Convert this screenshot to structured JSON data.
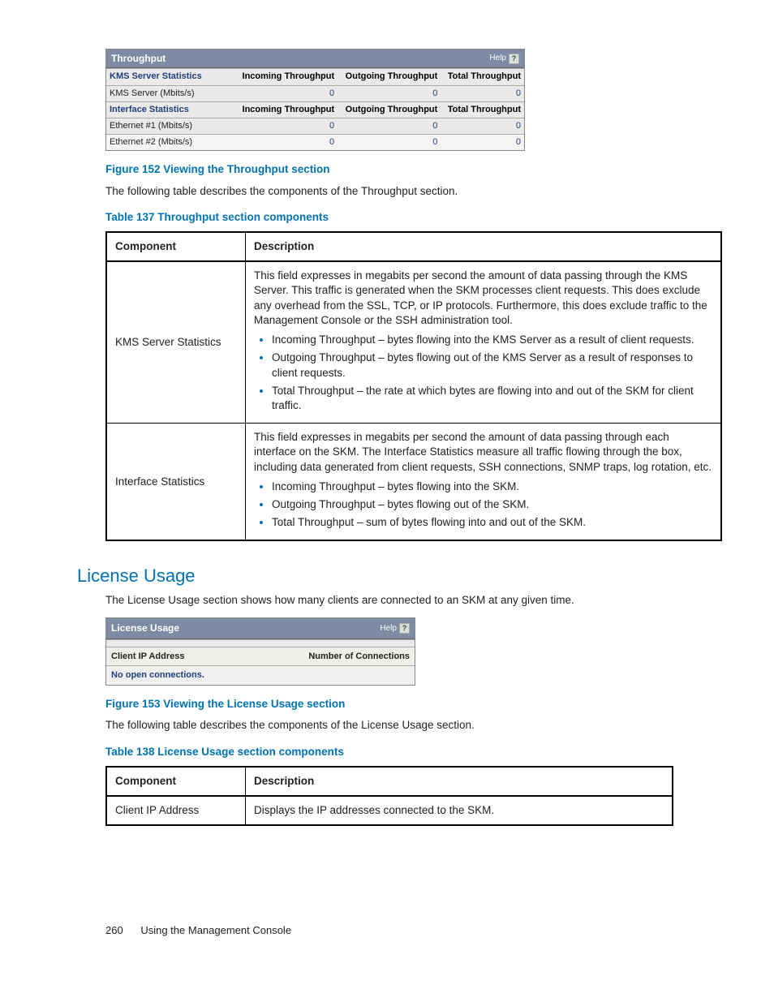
{
  "throughput_widget": {
    "title": "Throughput",
    "help": "Help",
    "sec1": "KMS Server Statistics",
    "sec2": "Interface Statistics",
    "c1": "Incoming Throughput",
    "c2": "Outgoing Throughput",
    "c3": "Total Throughput",
    "r1_label": "KMS Server (Mbits/s)",
    "r1_v1": "0",
    "r1_v2": "0",
    "r1_v3": "0",
    "r2_label": "Ethernet #1 (Mbits/s)",
    "r2_v1": "0",
    "r2_v2": "0",
    "r2_v3": "0",
    "r3_label": "Ethernet #2 (Mbits/s)",
    "r3_v1": "0",
    "r3_v2": "0",
    "r3_v3": "0"
  },
  "fig152": "Figure 152 Viewing the Throughput section",
  "fig152_desc": "The following table describes the components of the Throughput section.",
  "tab137": "Table 137 Throughput section components",
  "comp_hdr1": "Component",
  "comp_hdr2": "Description",
  "t137": {
    "r1_comp": "KMS Server Statistics",
    "r1_intro": "This field expresses in megabits per second the amount of data passing through the KMS Server. This traffic is generated when the SKM processes client requests. This does exclude any overhead from the SSL, TCP, or IP protocols. Furthermore, this does exclude traffic to the Management Console or the SSH administration tool.",
    "r1_b1": "Incoming Throughput – bytes flowing into the KMS Server as a result of client requests.",
    "r1_b2": "Outgoing Throughput – bytes flowing out of the KMS Server as a result of responses to client requests.",
    "r1_b3": "Total Throughput – the rate at which bytes are flowing into and out of the SKM for client traffic.",
    "r2_comp": "Interface Statistics",
    "r2_intro": "This field expresses in megabits per second the amount of data passing through each interface on the SKM. The Interface Statistics measure all traffic flowing through the box, including data generated from client requests, SSH connections, SNMP traps, log rotation, etc.",
    "r2_b1": "Incoming Throughput – bytes flowing into the SKM.",
    "r2_b2": "Outgoing Throughput – bytes flowing out of the SKM.",
    "r2_b3": "Total Throughput – sum of bytes flowing into and out of the SKM."
  },
  "license_heading": "License Usage",
  "license_intro": "The License Usage section shows how many clients are connected to an SKM at any given time.",
  "license_widget": {
    "title": "License Usage",
    "help": "Help",
    "col1": "Client IP Address",
    "col2": "Number of Connections",
    "empty": "No open connections."
  },
  "fig153": "Figure 153 Viewing the License Usage section",
  "fig153_desc": "The following table describes the components of the License Usage section.",
  "tab138": "Table 138 License Usage section components",
  "t138": {
    "r1_comp": "Client IP Address",
    "r1_desc": "Displays the IP addresses connected to the SKM."
  },
  "footer": {
    "page": "260",
    "title": "Using the Management Console"
  }
}
